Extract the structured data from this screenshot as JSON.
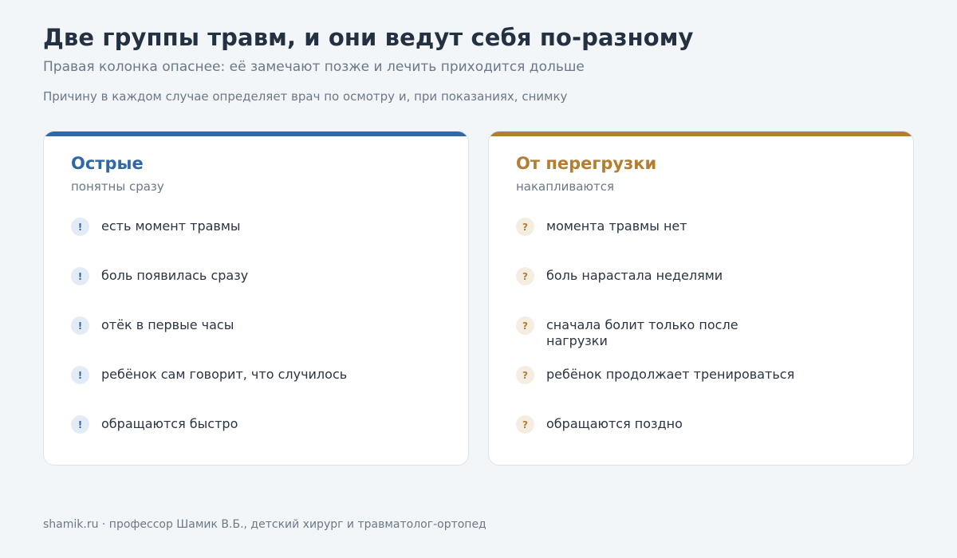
{
  "header": {
    "title": "Две группы травм, и они ведут себя по-разному",
    "subtitle": "Правая колонка опаснее: её замечают позже и лечить приходится дольше",
    "note": "Причину в каждом случае определяет врач по осмотру и, при показаниях, снимку"
  },
  "columns": [
    {
      "title": "Острые",
      "subtitle": "понятны сразу",
      "badge": "!",
      "accent": "#2f68a5",
      "items": [
        "есть момент травмы",
        "боль появилась сразу",
        "отёк в первые часы",
        "ребёнок сам говорит, что случилось",
        "обращаются быстро"
      ]
    },
    {
      "title": "От перегрузки",
      "subtitle": "накапливаются",
      "badge": "?",
      "accent": "#b27e32",
      "items": [
        "момента травмы нет",
        "боль нарастала неделями",
        "сначала болит только после нагрузки",
        "ребёнок продолжает тренироваться",
        "обращаются поздно"
      ]
    }
  ],
  "footer": {
    "text": "shamik.ru · профессор Шамик В.Б., детский хирург и травматолог-ортопед"
  }
}
